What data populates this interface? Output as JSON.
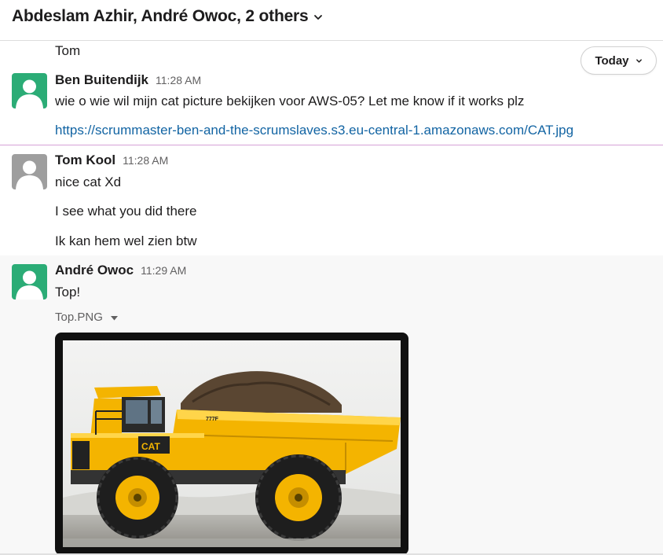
{
  "header": {
    "title": "Abdeslam Azhir, André Owoc, 2 others",
    "chevron_icon": "chevron-down-icon"
  },
  "date_pill": {
    "label": "Today"
  },
  "messages": {
    "prev_tail": "Tom",
    "m1": {
      "author": "Ben Buitendijk",
      "time": "11:28 AM",
      "text": "wie o wie wil mijn cat picture bekijken voor AWS-05? Let me know if it works plz",
      "link": "https://scrummaster-ben-and-the-scrumslaves.s3.eu-central-1.amazonaws.com/CAT.jpg",
      "avatar_color": "#2bac76"
    },
    "m2": {
      "author": "Tom Kool",
      "time": "11:28 AM",
      "lines": [
        "nice cat Xd",
        "I see what you did there",
        "Ik kan hem wel zien btw"
      ],
      "avatar_color": "#9e9e9e"
    },
    "m3": {
      "author": "André Owoc",
      "time": "11:29 AM",
      "text": "Top!",
      "file_name": "Top.PNG",
      "image_subject": "yellow CAT dump truck loaded with dirt",
      "avatar_color": "#2bac76"
    }
  },
  "colors": {
    "link": "#1264a3",
    "new_divider": "#d6a2d8",
    "truck_yellow": "#f4b400"
  }
}
